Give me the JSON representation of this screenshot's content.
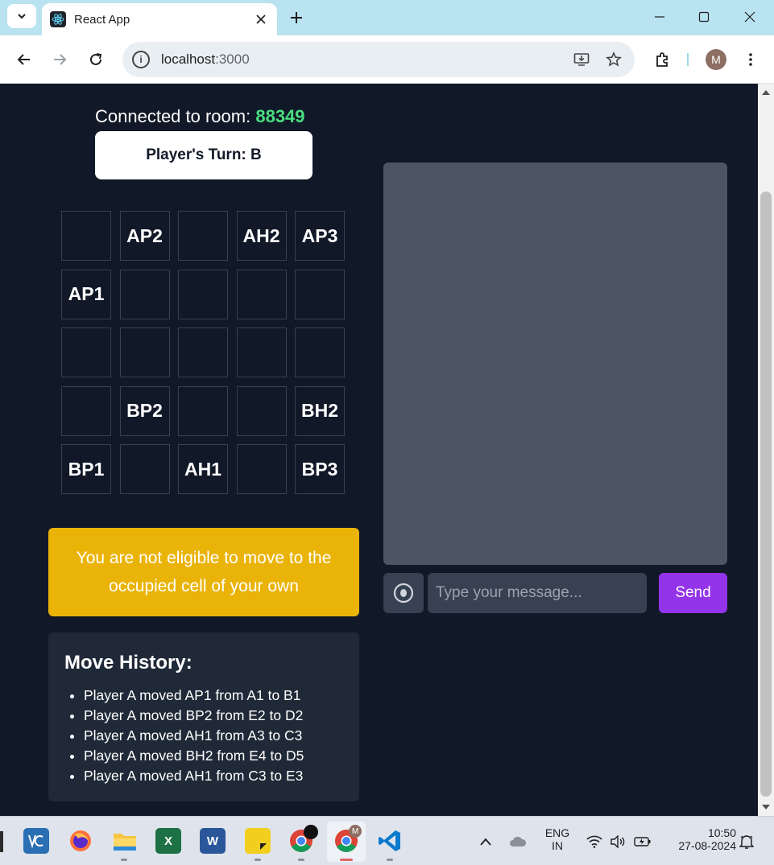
{
  "browser": {
    "tab_title": "React App",
    "url_host": "localhost",
    "url_port": ":3000",
    "profile_initial": "M"
  },
  "page": {
    "room_label": "Connected to room: ",
    "room_code": "88349",
    "turn_text": "Player's Turn: B",
    "board": [
      [
        "",
        "AP2",
        "",
        "AH2",
        "AP3"
      ],
      [
        "AP1",
        "",
        "",
        "",
        ""
      ],
      [
        "",
        "",
        "",
        "",
        ""
      ],
      [
        "",
        "BP2",
        "",
        "",
        "BH2"
      ],
      [
        "BP1",
        "",
        "AH1",
        "",
        "BP3"
      ]
    ],
    "warning": "You are not eligible to move to the occupied cell of your own",
    "history_title": "Move History:",
    "history": [
      "Player A moved AP1 from A1 to B1",
      "Player A moved BP2 from E2 to D2",
      "Player A moved AH1 from A3 to C3",
      "Player A moved BH2 from E4 to D5",
      "Player A moved AH1 from C3 to E3"
    ],
    "chat": {
      "placeholder": "Type your message...",
      "send_label": "Send"
    }
  },
  "taskbar": {
    "apps": [
      "vcxsrv-icon",
      "firefox-icon",
      "file-explorer-icon",
      "excel-icon",
      "word-icon",
      "sticky-notes-icon",
      "chrome-icon",
      "chrome-profile-icon",
      "vscode-icon"
    ],
    "lang_1": "ENG",
    "lang_2": "IN",
    "time": "10:50",
    "date": "27-08-2024"
  },
  "colors": {
    "page_bg": "#111827",
    "room_code": "#4ade80",
    "warning_bg": "#eab308",
    "history_bg": "#1f2937",
    "chat_bg": "#4b5563",
    "send_bg": "#9333ea"
  }
}
